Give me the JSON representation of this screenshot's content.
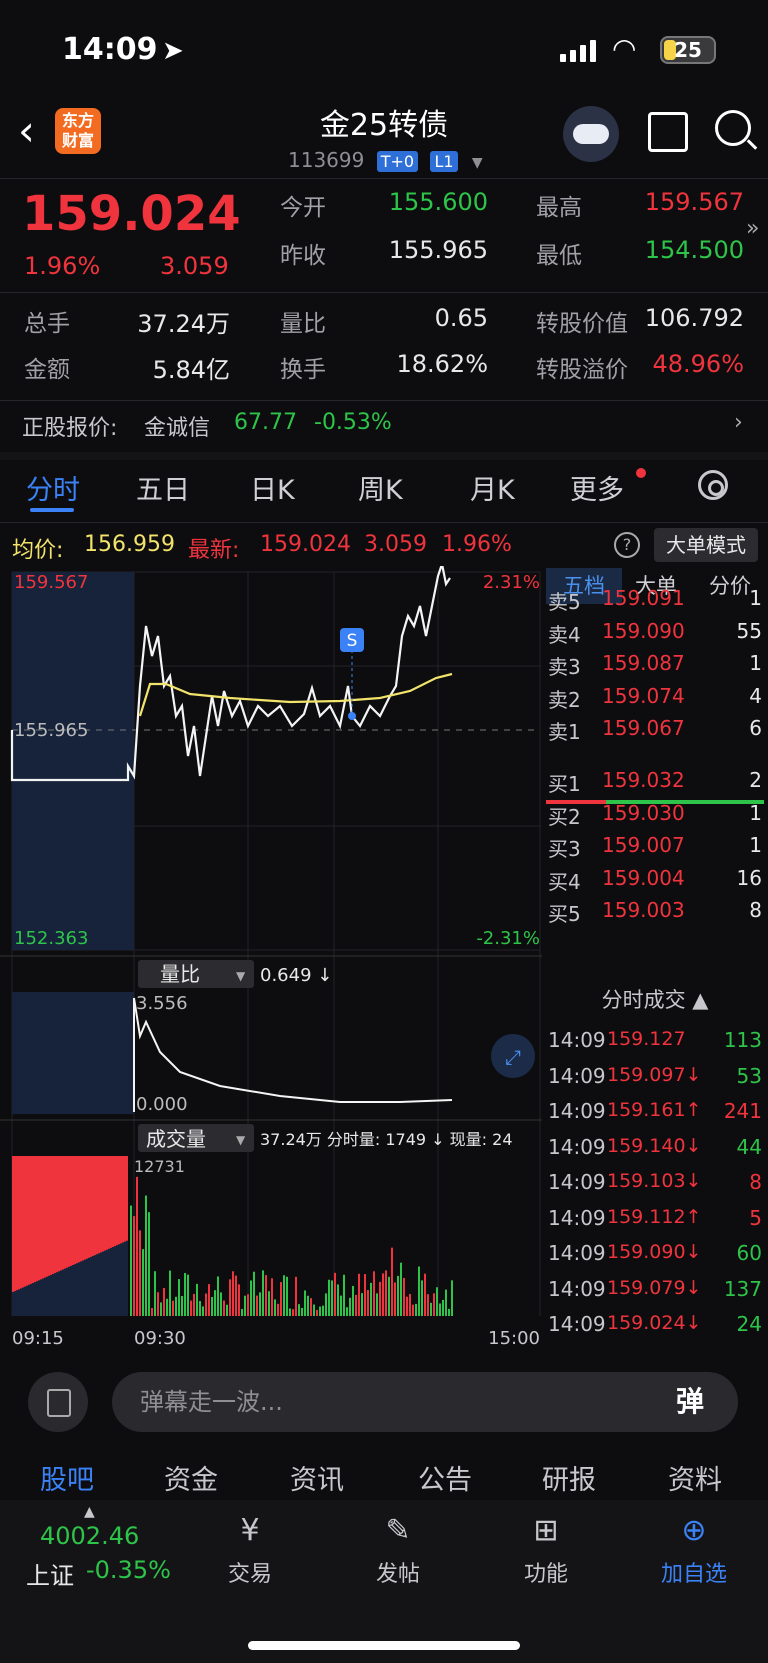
{
  "status": {
    "time": "14:09",
    "battery": "25"
  },
  "header": {
    "logo": "东方\n财富",
    "title": "金25转债",
    "code": "113699",
    "tag1": "T+0",
    "tag2": "L1"
  },
  "quote": {
    "price": "159.024",
    "pct": "1.96%",
    "chg": "3.059",
    "open_label": "今开",
    "open": "155.600",
    "prev_label": "昨收",
    "prev": "155.965",
    "high_label": "最高",
    "high": "159.567",
    "low_label": "最低",
    "low": "154.500"
  },
  "stats": {
    "vol_label": "总手",
    "vol": "37.24万",
    "amt_label": "金额",
    "amt": "5.84亿",
    "ratio_label": "量比",
    "ratio": "0.65",
    "turn_label": "换手",
    "turn": "18.62%",
    "conv_label": "转股价值",
    "conv": "106.792",
    "prem_label": "转股溢价",
    "prem": "48.96%"
  },
  "stock": {
    "label": "正股报价:",
    "name": "金诚信",
    "price": "67.77",
    "pct": "-0.53%"
  },
  "tabs": [
    "分时",
    "五日",
    "日K",
    "周K",
    "月K",
    "更多"
  ],
  "avg": {
    "avg_label": "均价:",
    "avg": "156.959",
    "last_label": "最新:",
    "last": "159.024",
    "chg": "3.059",
    "pct": "1.96%",
    "mode": "大单模式"
  },
  "chart_data": {
    "type": "line",
    "title": "",
    "ylim": [
      152.363,
      159.567
    ],
    "top_left": "159.567",
    "top_right": "2.31%",
    "bottom_left": "152.363",
    "bottom_right": "-2.31%",
    "ref_label": "155.965",
    "marker": "S",
    "ratio_label": "量比",
    "ratio_value": "0.649 ↓",
    "ratio_top": "3.556",
    "ratio_bottom": "0.000",
    "vol_label": "成交量",
    "vol_info": "37.24万 分时量: 1749 ↓ 现量: 24",
    "vol_top": "12731",
    "x_ticks": [
      "09:15",
      "09:30",
      "15:00"
    ]
  },
  "book": {
    "tabs": [
      "五档",
      "大单",
      "分价"
    ],
    "asks": [
      {
        "label": "卖5",
        "price": "159.091",
        "vol": "1"
      },
      {
        "label": "卖4",
        "price": "159.090",
        "vol": "55"
      },
      {
        "label": "卖3",
        "price": "159.087",
        "vol": "1"
      },
      {
        "label": "卖2",
        "price": "159.074",
        "vol": "4"
      },
      {
        "label": "卖1",
        "price": "159.067",
        "vol": "6"
      }
    ],
    "bids": [
      {
        "label": "买1",
        "price": "159.032",
        "vol": "2"
      },
      {
        "label": "买2",
        "price": "159.030",
        "vol": "1"
      },
      {
        "label": "买3",
        "price": "159.007",
        "vol": "1"
      },
      {
        "label": "买4",
        "price": "159.004",
        "vol": "16"
      },
      {
        "label": "买5",
        "price": "159.003",
        "vol": "8"
      }
    ],
    "ticks_title": "分时成交 ▲",
    "ticks": [
      {
        "time": "14:09",
        "price": "159.127",
        "vol": "113",
        "pc": "red",
        "vc": "green"
      },
      {
        "time": "14:09",
        "price": "159.097↓",
        "vol": "53",
        "pc": "red",
        "vc": "green"
      },
      {
        "time": "14:09",
        "price": "159.161↑",
        "vol": "241",
        "pc": "red",
        "vc": "red"
      },
      {
        "time": "14:09",
        "price": "159.140↓",
        "vol": "44",
        "pc": "red",
        "vc": "green"
      },
      {
        "time": "14:09",
        "price": "159.103↓",
        "vol": "8",
        "pc": "red",
        "vc": "red"
      },
      {
        "time": "14:09",
        "price": "159.112↑",
        "vol": "5",
        "pc": "red",
        "vc": "red"
      },
      {
        "time": "14:09",
        "price": "159.090↓",
        "vol": "60",
        "pc": "red",
        "vc": "green"
      },
      {
        "time": "14:09",
        "price": "159.079↓",
        "vol": "137",
        "pc": "red",
        "vc": "green"
      },
      {
        "time": "14:09",
        "price": "159.024↓",
        "vol": "24",
        "pc": "red",
        "vc": "green"
      }
    ]
  },
  "danmu": {
    "placeholder": "弹幕走一波...",
    "btn": "弹"
  },
  "subnav": [
    "股吧",
    "资金",
    "资讯",
    "公告",
    "研报",
    "资料"
  ],
  "bottom": {
    "index_value": "4002.46",
    "index_name": "上证",
    "index_pct": "-0.35%",
    "items": [
      {
        "label": "交易",
        "icon": "yen-icon"
      },
      {
        "label": "发帖",
        "icon": "edit-icon"
      },
      {
        "label": "功能",
        "icon": "grid-icon"
      },
      {
        "label": "加自选",
        "icon": "plus-icon"
      }
    ]
  },
  "colors": {
    "up": "#f0343d",
    "down": "#2ec44a",
    "accent": "#3b82f6",
    "avg_line": "#f2e36b"
  }
}
